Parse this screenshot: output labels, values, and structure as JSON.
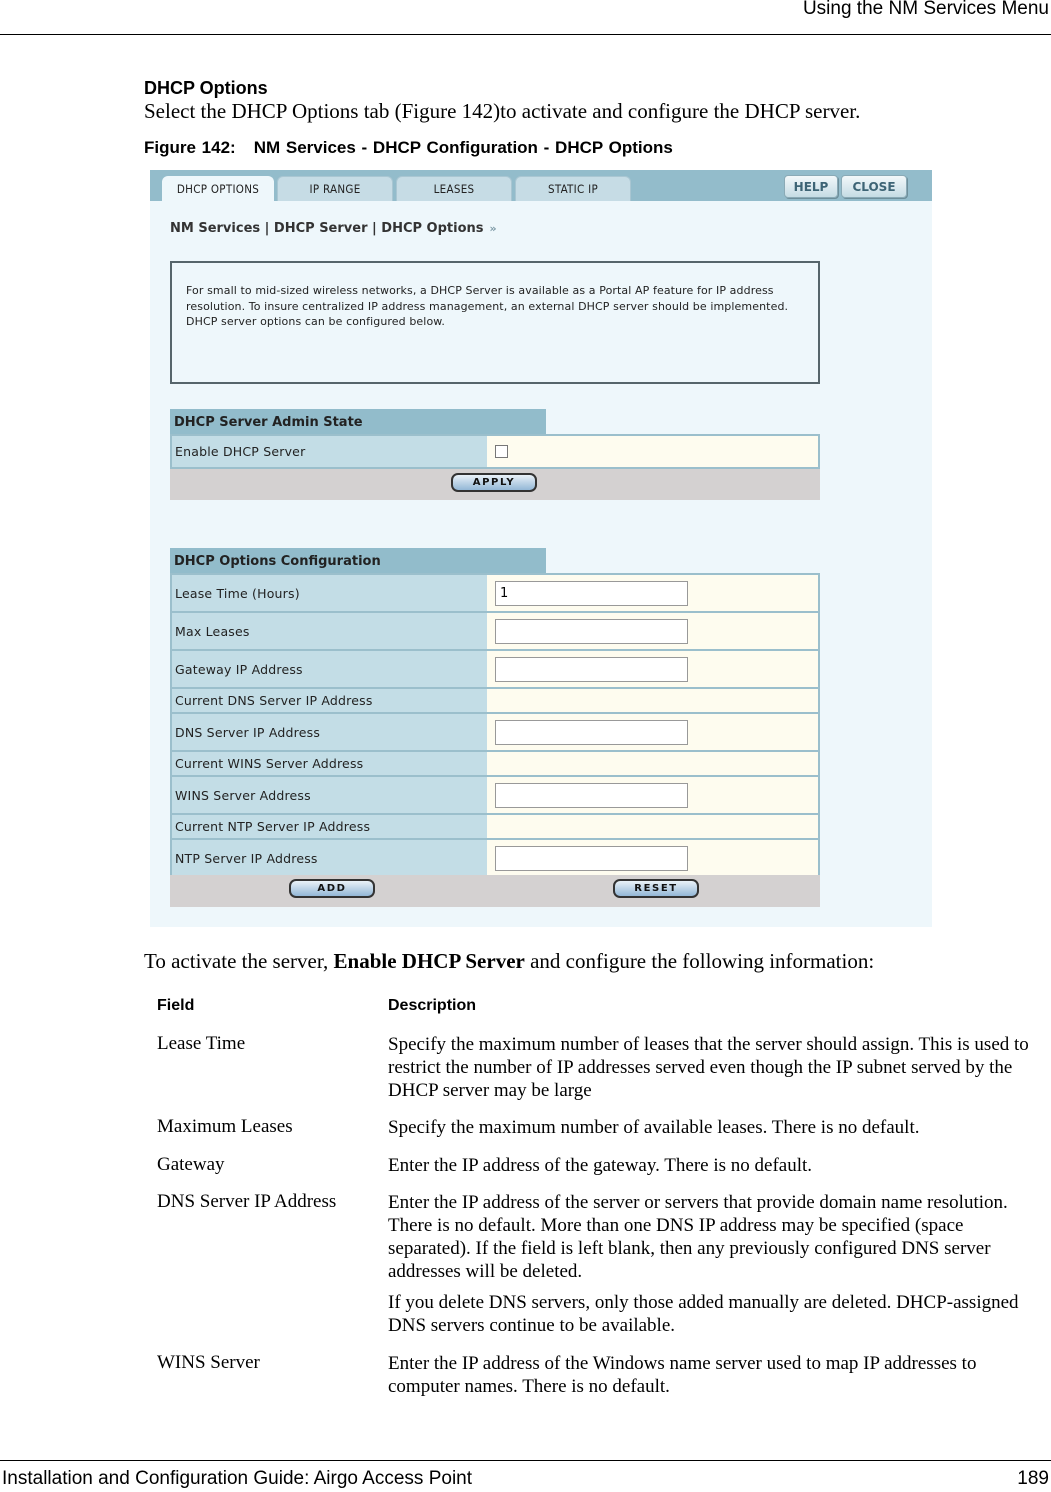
{
  "page_header": {
    "title": "Using the NM Services Menu"
  },
  "section": {
    "title": "DHCP Options",
    "intro": "Select the DHCP Options tab (Figure 142)to activate and configure the DHCP server."
  },
  "figure": {
    "number": "Figure 142:",
    "caption": "NM Services - DHCP Configuration - DHCP Options"
  },
  "ui": {
    "tabs": [
      {
        "label": "DHCP OPTIONS",
        "active": true
      },
      {
        "label": "IP RANGE",
        "active": false
      },
      {
        "label": "LEASES",
        "active": false
      },
      {
        "label": "STATIC IP",
        "active": false
      }
    ],
    "help_label": "HELP",
    "close_label": "CLOSE",
    "breadcrumb": "NM Services | DHCP Server | DHCP Options",
    "breadcrumb_arrows": "»",
    "info_text": "For small to mid-sized wireless networks, a DHCP Server is available as a Portal AP feature for IP address resolution. To insure centralized IP address management, an external DHCP server should be implemented. DHCP server options can be configured below.",
    "admin_state": {
      "header": "DHCP Server Admin State",
      "enable_label": "Enable DHCP Server",
      "enable_checked": false,
      "apply_label": "APPLY"
    },
    "options_config": {
      "header": "DHCP Options Configuration",
      "rows": [
        {
          "label": "Lease Time (Hours)",
          "type": "input",
          "value": "1"
        },
        {
          "label": "Max Leases",
          "type": "input",
          "value": ""
        },
        {
          "label": "Gateway IP Address",
          "type": "input",
          "value": ""
        },
        {
          "label": "Current DNS Server IP Address",
          "type": "readonly",
          "value": ""
        },
        {
          "label": "DNS Server IP Address",
          "type": "input",
          "value": ""
        },
        {
          "label": "Current WINS Server Address",
          "type": "readonly",
          "value": ""
        },
        {
          "label": "WINS Server Address",
          "type": "input",
          "value": ""
        },
        {
          "label": "Current NTP Server IP Address",
          "type": "readonly",
          "value": ""
        },
        {
          "label": "NTP Server IP Address",
          "type": "input",
          "value": ""
        }
      ],
      "add_label": "ADD",
      "reset_label": "RESET"
    },
    "colors": {
      "tabbar": "#93bccb",
      "panel_bg": "#eef7fb",
      "label_cell": "#c3dde6",
      "value_cell": "#fefcef",
      "button_bar": "#d4d1d1"
    }
  },
  "lead": {
    "before": "To activate the server, ",
    "bold": "Enable DHCP Server",
    "after": " and configure the following information:"
  },
  "desc_table": {
    "headers": {
      "field": "Field",
      "description": "Description"
    },
    "rows": [
      {
        "field": "Lease Time",
        "description": [
          "Specify the maximum number of leases that the server should assign. This is used to restrict the number of IP addresses served even though the IP subnet served by the DHCP server may be large"
        ]
      },
      {
        "field": "Maximum Leases",
        "description": [
          "Specify the maximum number of available leases. There is no default."
        ]
      },
      {
        "field": "Gateway",
        "description": [
          "Enter the IP address of the gateway. There is no default."
        ]
      },
      {
        "field": "DNS Server IP Address",
        "description": [
          "Enter the IP address of the server or servers that provide domain name resolution. There is no default. More than one DNS IP address may be specified (space separated). If the field is left blank, then any previously configured DNS server addresses will be deleted.",
          "If you delete DNS servers, only those added manually are deleted. DHCP-assigned DNS servers continue to be available."
        ]
      },
      {
        "field": "WINS Server",
        "description": [
          "Enter the IP address of the Windows name server used to map IP addresses to computer names. There is no default."
        ]
      }
    ]
  },
  "footer": {
    "left": "Installation and Configuration Guide: Airgo Access Point",
    "page": "189"
  }
}
